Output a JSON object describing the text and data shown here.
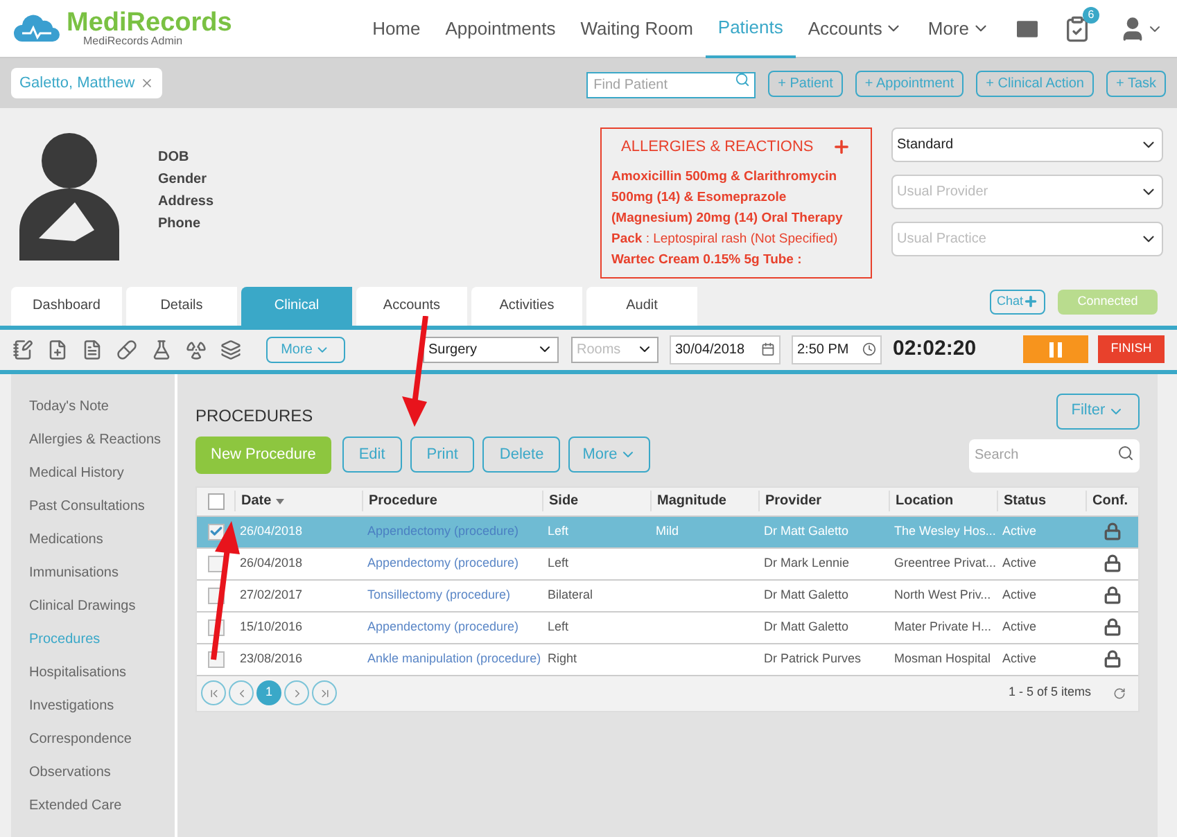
{
  "nav": {
    "logo": "MediRecords",
    "subtitle": "MediRecords Admin",
    "items": [
      {
        "label": "Home",
        "selected": false,
        "dropdown": false
      },
      {
        "label": "Appointments",
        "selected": false,
        "dropdown": false
      },
      {
        "label": "Waiting Room",
        "selected": false,
        "dropdown": false
      },
      {
        "label": "Patients",
        "selected": true,
        "dropdown": false
      },
      {
        "label": "Accounts",
        "selected": false,
        "dropdown": true
      },
      {
        "label": "More",
        "selected": false,
        "dropdown": true
      }
    ],
    "badge": "6"
  },
  "patient_bar": {
    "patient_tab": "Galetto, Matthew",
    "search": {
      "placeholder": "Find Patient"
    },
    "buttons": [
      "+ Patient",
      "+ Appointment",
      "+ Clinical Action",
      "+ Task"
    ]
  },
  "patient": {
    "fields": [
      "DOB",
      "Gender",
      "Address",
      "Phone"
    ],
    "allergies": {
      "title": "ALLERGIES & REACTIONS",
      "entries": [
        {
          "drug": "Amoxicillin 500mg & Clarithromycin 500mg (14) & Esomeprazole (Magnesium) 20mg (14) Oral Therapy Pack ",
          "reaction": ": Leptospiral rash (Not Specified)"
        },
        {
          "drug": "Wartec Cream 0.15% 5g Tube :"
        }
      ]
    },
    "selects": [
      {
        "value": "Standard"
      },
      {
        "placeholder": "Usual Provider"
      },
      {
        "placeholder": "Usual Practice"
      }
    ],
    "chat": "Chat",
    "connection": "Connected"
  },
  "tabs": [
    {
      "label": "Dashboard",
      "selected": false
    },
    {
      "label": "Details",
      "selected": false
    },
    {
      "label": "Clinical",
      "selected": true
    },
    {
      "label": "Accounts",
      "selected": false
    },
    {
      "label": "Activities",
      "selected": false
    },
    {
      "label": "Audit",
      "selected": false
    }
  ],
  "toolbar": {
    "more": "More",
    "location": "Surgery",
    "rooms": {
      "placeholder": "Rooms"
    },
    "date": "30/04/2018",
    "time": "2:50 PM",
    "timer": "02:02:20",
    "finish": "FINISH"
  },
  "sidebar": {
    "items": [
      {
        "label": "Today's Note",
        "selected": false
      },
      {
        "label": "Allergies & Reactions",
        "selected": false
      },
      {
        "label": "Medical History",
        "selected": false
      },
      {
        "label": "Past Consultations",
        "selected": false
      },
      {
        "label": "Medications",
        "selected": false
      },
      {
        "label": "Immunisations",
        "selected": false
      },
      {
        "label": "Clinical Drawings",
        "selected": false
      },
      {
        "label": "Procedures",
        "selected": true
      },
      {
        "label": "Hospitalisations",
        "selected": false
      },
      {
        "label": "Investigations",
        "selected": false
      },
      {
        "label": "Correspondence",
        "selected": false
      },
      {
        "label": "Observations",
        "selected": false
      },
      {
        "label": "Extended Care",
        "selected": false
      }
    ]
  },
  "procedures": {
    "title": "PROCEDURES",
    "filter": "Filter",
    "actions": [
      {
        "label": "New Procedure",
        "kind": "primary"
      },
      {
        "label": "Edit",
        "kind": "outline"
      },
      {
        "label": "Print",
        "kind": "outline"
      },
      {
        "label": "Delete",
        "kind": "outline"
      },
      {
        "label": "More",
        "kind": "dropdown"
      }
    ],
    "search": {
      "placeholder": "Search"
    },
    "select_all": {
      "checked": false
    },
    "columns": [
      {
        "label": "Date",
        "sorted": true
      },
      {
        "label": "Procedure",
        "sorted": false
      },
      {
        "label": "Side",
        "sorted": false
      },
      {
        "label": "Magnitude",
        "sorted": false
      },
      {
        "label": "Provider",
        "sorted": false
      },
      {
        "label": "Location",
        "sorted": false
      },
      {
        "label": "Status",
        "sorted": false
      },
      {
        "label": "Conf.",
        "sorted": false
      }
    ],
    "rows": [
      {
        "selected": true,
        "date": "26/04/2018",
        "procedure": "Appendectomy (procedure)",
        "side": "Left",
        "magnitude": "Mild",
        "provider": "Dr Matt Galetto",
        "location": "The Wesley Hos...",
        "status": "Active"
      },
      {
        "selected": false,
        "date": "26/04/2018",
        "procedure": "Appendectomy (procedure)",
        "side": "Left",
        "provider": "Dr Mark Lennie",
        "location": "Greentree Privat...",
        "status": "Active"
      },
      {
        "selected": false,
        "date": "27/02/2017",
        "procedure": "Tonsillectomy (procedure)",
        "side": "Bilateral",
        "provider": "Dr Matt Galetto",
        "location": "North West Priv...",
        "status": "Active"
      },
      {
        "selected": false,
        "date": "15/10/2016",
        "procedure": "Appendectomy (procedure)",
        "side": "Left",
        "provider": "Dr Matt Galetto",
        "location": "Mater Private H...",
        "status": "Active"
      },
      {
        "selected": false,
        "date": "23/08/2016",
        "procedure": "Ankle manipulation (procedure)",
        "side": "Right",
        "provider": "Dr Patrick Purves",
        "location": "Mosman Hospital",
        "status": "Active"
      }
    ],
    "pages": [
      {
        "label": "1",
        "selected": true
      }
    ],
    "summary": "1 - 5 of 5 items"
  }
}
